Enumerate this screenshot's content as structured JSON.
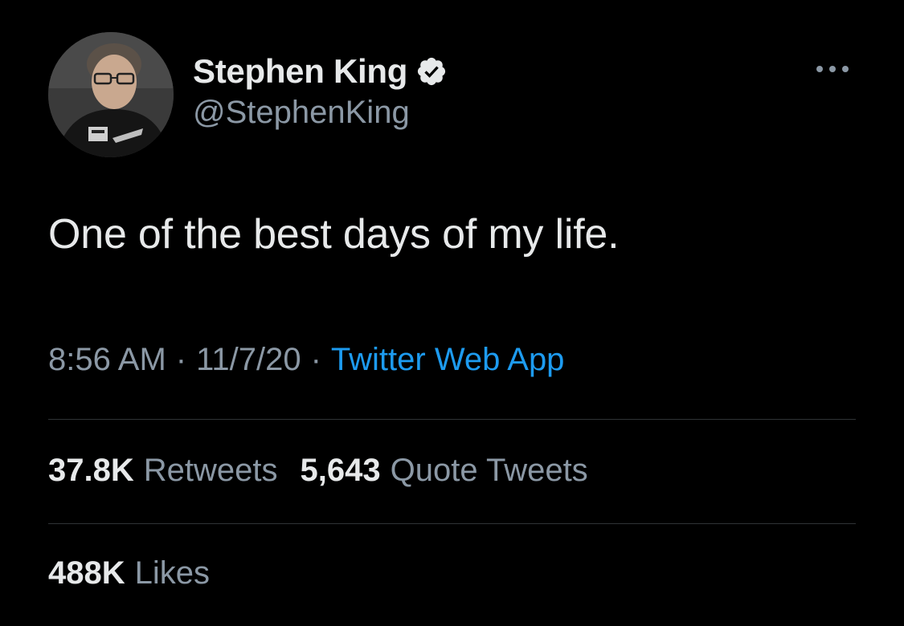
{
  "author": {
    "display_name": "Stephen King",
    "handle": "@StephenKing",
    "verified": true,
    "avatar_icon": "profile-photo"
  },
  "tweet": {
    "text": "One of the best days of my life.",
    "time": "8:56 AM",
    "date": "11/7/20",
    "separator": "·",
    "source": "Twitter Web App"
  },
  "stats": {
    "retweets_count": "37.8K",
    "retweets_label": "Retweets",
    "quotes_count": "5,643",
    "quotes_label": "Quote Tweets",
    "likes_count": "488K",
    "likes_label": "Likes"
  },
  "icons": {
    "verified": "verified-badge-icon",
    "more": "more-options-icon"
  },
  "colors": {
    "background": "#000000",
    "primary_text": "#e7e9ea",
    "secondary_text": "#8b98a5",
    "link": "#1d9bf0",
    "divider": "#2f3336"
  }
}
